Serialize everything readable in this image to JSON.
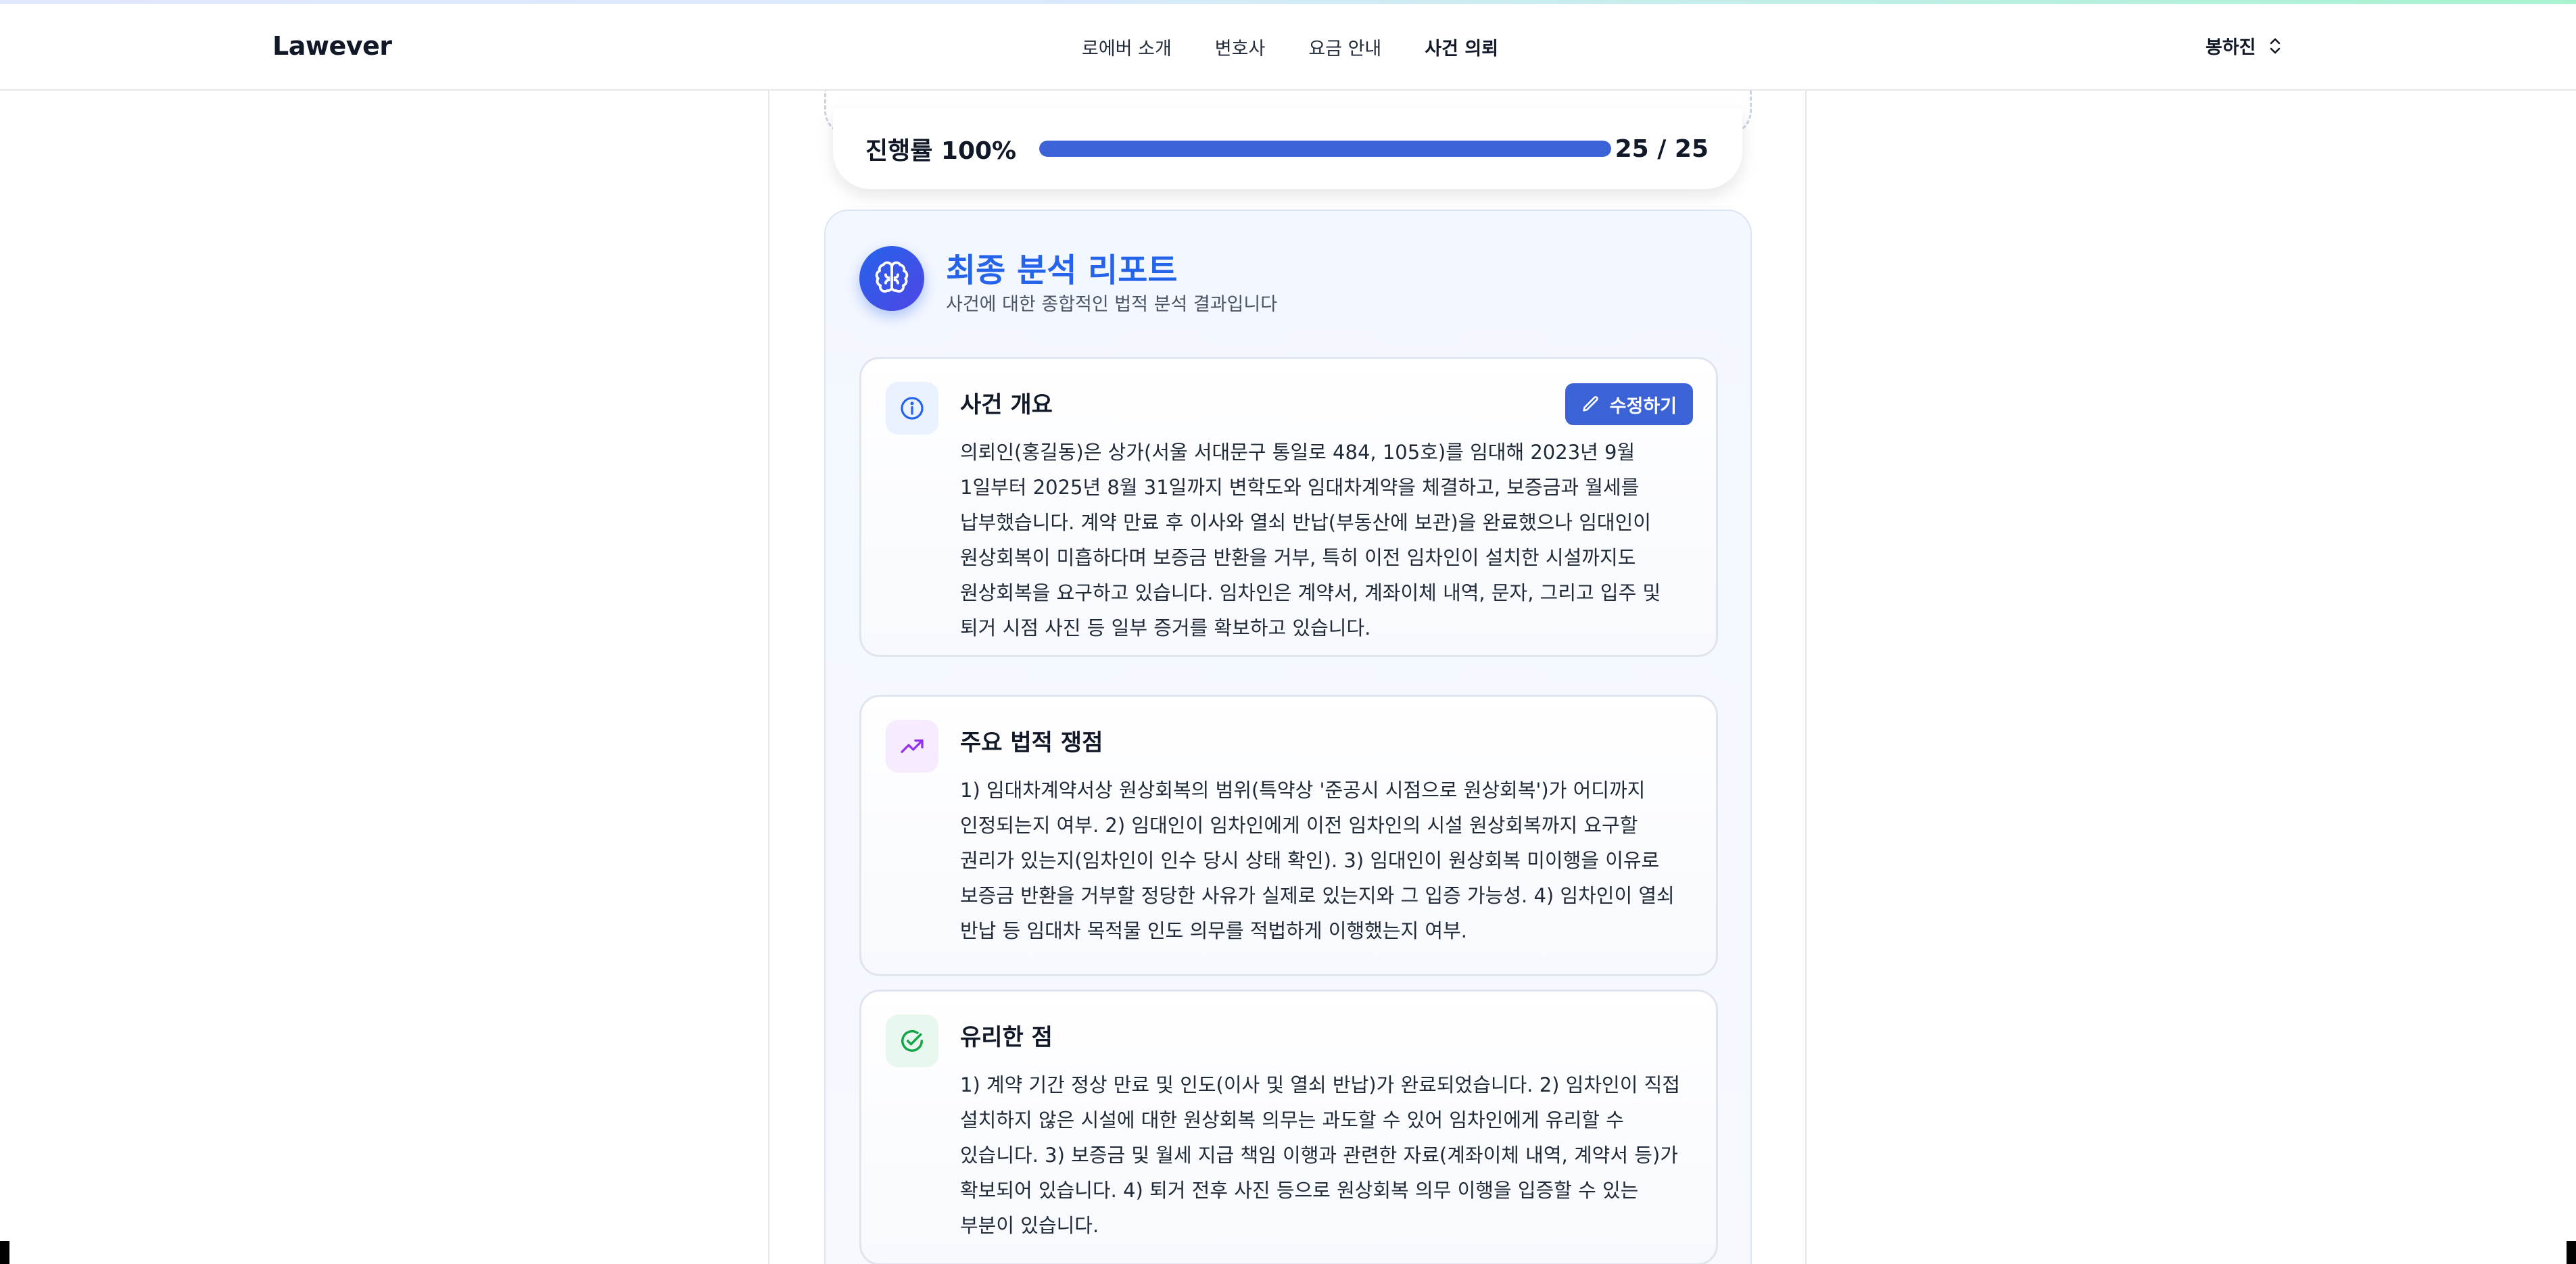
{
  "brand": {
    "logo": "Lawever"
  },
  "nav": {
    "links": [
      "로에버 소개",
      "변호사",
      "요금 안내",
      "사건 의뢰"
    ],
    "active_index": 3
  },
  "user": {
    "name": "봉하진"
  },
  "progress": {
    "label": "진행률 100%",
    "percent": 100,
    "count": "25 / 25"
  },
  "report": {
    "title": "최종 분석 리포트",
    "subtitle": "사건에 대한 종합적인 법적 분석 결과입니다",
    "sections": [
      {
        "title": "사건 개요",
        "icon": "info-icon",
        "edit_label": "수정하기",
        "body": "의뢰인(홍길동)은 상가(서울 서대문구 통일로 484, 105호)를 임대해 2023년 9월 1일부터 2025년 8월 31일까지 변학도와 임대차계약을 체결하고, 보증금과 월세를 납부했습니다. 계약 만료 후 이사와 열쇠 반납(부동산에 보관)을 완료했으나 임대인이 원상회복이 미흡하다며 보증금 반환을 거부, 특히 이전 임차인이 설치한 시설까지도 원상회복을 요구하고 있습니다. 임차인은 계약서, 계좌이체 내역, 문자, 그리고 입주 및 퇴거 시점 사진 등 일부 증거를 확보하고 있습니다."
      },
      {
        "title": "주요 법적 쟁점",
        "icon": "trending-up-icon",
        "body": "1) 임대차계약서상 원상회복의 범위(특약상 '준공시 시점으로 원상회복')가 어디까지 인정되는지 여부. 2) 임대인이 임차인에게 이전 임차인의 시설 원상회복까지 요구할 권리가 있는지(임차인이 인수 당시 상태 확인). 3) 임대인이 원상회복 미이행을 이유로 보증금 반환을 거부할 정당한 사유가 실제로 있는지와 그 입증 가능성. 4) 임차인이 열쇠 반납 등 임대차 목적물 인도 의무를 적법하게 이행했는지 여부."
      },
      {
        "title": "유리한 점",
        "icon": "check-circle-icon",
        "body": "1) 계약 기간 정상 만료 및 인도(이사 및 열쇠 반납)가 완료되었습니다. 2) 임차인이 직접 설치하지 않은 시설에 대한 원상회복 의무는 과도할 수 있어 임차인에게 유리할 수 있습니다. 3) 보증금 및 월세 지급 책임 이행과 관련한 자료(계좌이체 내역, 계약서 등)가 확보되어 있습니다. 4) 퇴거 전후 사진 등으로 원상회복 의무 이행을 입증할 수 있는 부분이 있습니다."
      }
    ]
  },
  "colors": {
    "accent": "#3b63d6",
    "title_blue": "#2563eb",
    "issues_icon": "#9333ea",
    "merits_icon": "#16a34a"
  }
}
